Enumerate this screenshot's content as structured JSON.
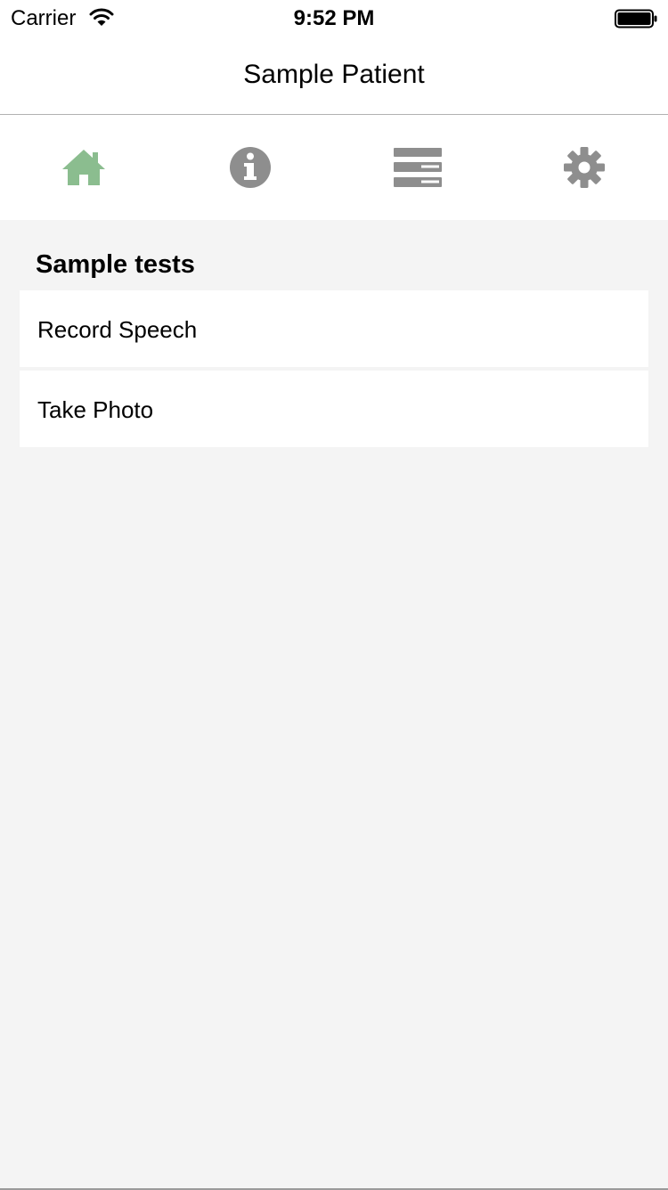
{
  "status_bar": {
    "carrier": "Carrier",
    "time": "9:52 PM",
    "icons": [
      "wifi-icon",
      "battery-icon"
    ]
  },
  "nav": {
    "title": "Sample Patient"
  },
  "tabs": [
    {
      "icon": "home-icon",
      "selected": true,
      "color": "#8bbd8f"
    },
    {
      "icon": "info-icon",
      "selected": false,
      "color": "#8e8e8e"
    },
    {
      "icon": "list-icon",
      "selected": false,
      "color": "#8e8e8e"
    },
    {
      "icon": "gear-icon",
      "selected": false,
      "color": "#8e8e8e"
    }
  ],
  "section": {
    "title": "Sample tests"
  },
  "items": [
    {
      "label": "Record Speech"
    },
    {
      "label": "Take Photo"
    }
  ],
  "colors": {
    "background": "#f4f4f4",
    "accent": "#8bbd8f",
    "icon_inactive": "#8e8e8e"
  }
}
